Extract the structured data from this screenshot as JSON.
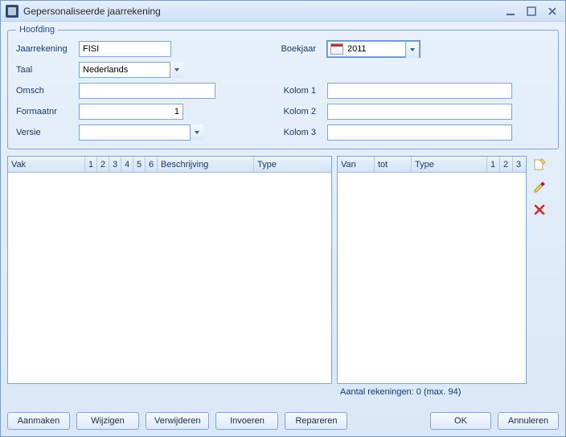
{
  "window": {
    "title": "Gepersonaliseerde jaarrekening"
  },
  "hoofding": {
    "legend": "Hoofding",
    "labels": {
      "jaarrekening": "Jaarrekening",
      "taal": "Taal",
      "omsch": "Omsch",
      "formaatnr": "Formaatnr",
      "versie": "Versie",
      "boekjaar": "Boekjaar",
      "kolom1": "Kolom 1",
      "kolom2": "Kolom 2",
      "kolom3": "Kolom 3"
    },
    "values": {
      "jaarrekening": "FISI",
      "taal": "Nederlands",
      "omsch": "",
      "formaatnr": "1",
      "versie": "",
      "boekjaar": "2011",
      "kolom1": "",
      "kolom2": "",
      "kolom3": ""
    }
  },
  "grid_left": {
    "headers": {
      "vak": "Vak",
      "c1": "1",
      "c2": "2",
      "c3": "3",
      "c4": "4",
      "c5": "5",
      "c6": "6",
      "beschrijving": "Beschrijving",
      "type": "Type"
    },
    "rows": []
  },
  "grid_right": {
    "headers": {
      "van": "Van",
      "tot": "tot",
      "type": "Type",
      "c1": "1",
      "c2": "2",
      "c3": "3"
    },
    "rows": []
  },
  "status": {
    "count_text": "Aantal rekeningen: 0 (max. 94)"
  },
  "buttons": {
    "aanmaken": "Aanmaken",
    "wijzigen": "Wijzigen",
    "verwijderen": "Verwijderen",
    "invoeren": "Invoeren",
    "repareren": "Repareren",
    "ok": "OK",
    "annuleren": "Annuleren"
  },
  "icons": {
    "new": "new-icon",
    "edit": "edit-icon",
    "delete": "delete-icon"
  }
}
